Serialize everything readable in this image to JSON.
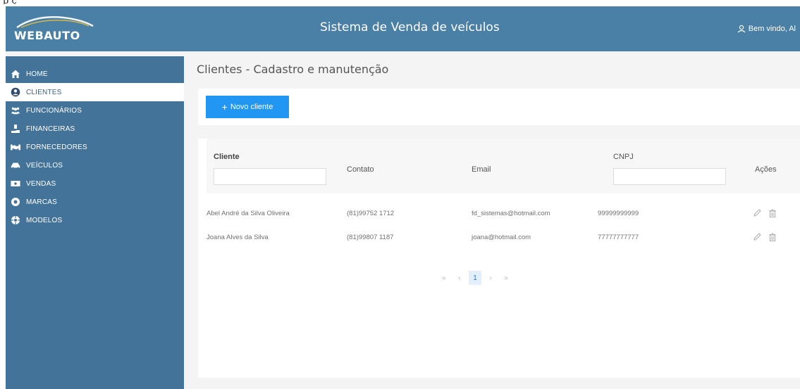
{
  "caption": "p ç",
  "header": {
    "logo_text": "WEBAUTO",
    "title": "Sistema de Venda de veículos",
    "user_greeting": "Bem vindo, Al"
  },
  "sidebar": {
    "items": [
      {
        "label": "HOME",
        "icon": "home-icon"
      },
      {
        "label": "CLIENTES",
        "icon": "user-circle-icon",
        "active": true
      },
      {
        "label": "FUNCIONÁRIOS",
        "icon": "users-icon"
      },
      {
        "label": "FINANCEIRAS",
        "icon": "money-hand-icon"
      },
      {
        "label": "FORNECEDORES",
        "icon": "handshake-icon"
      },
      {
        "label": "VEÍCULOS",
        "icon": "car-icon"
      },
      {
        "label": "VENDAS",
        "icon": "cash-icon"
      },
      {
        "label": "MARCAS",
        "icon": "badge-icon"
      },
      {
        "label": "MODELOS",
        "icon": "gear-icon"
      }
    ]
  },
  "main": {
    "title": "Clientes - Cadastro e manutenção",
    "new_button": "Novo cliente",
    "columns": {
      "cliente": "Cliente",
      "contato": "Contato",
      "email": "Email",
      "cnpj": "CNPJ",
      "acoes": "Ações"
    },
    "filters": {
      "cliente": "",
      "cnpj": ""
    },
    "rows": [
      {
        "cliente": "Abel André da Silva Oliveira",
        "contato": "(81)99752 1712",
        "email": "fd_sistemas@hotmail.com",
        "cnpj": "99999999999"
      },
      {
        "cliente": "Joana Alves da Silva",
        "contato": "(81)99807 1187",
        "email": "joana@hotmail.com",
        "cnpj": "77777777777"
      }
    ],
    "pager": {
      "first": "«",
      "prev": "‹",
      "current": "1",
      "next": "›",
      "last": "»"
    }
  },
  "colors": {
    "header": "#4a7fa6",
    "sidebar": "#44739a",
    "primary_button": "#2196f3"
  }
}
